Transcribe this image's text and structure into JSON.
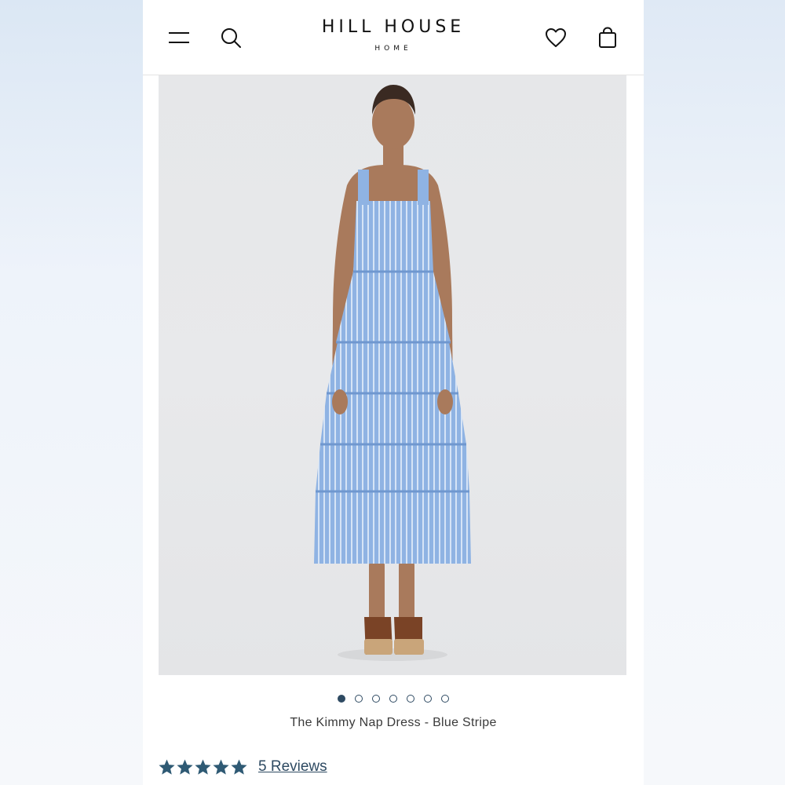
{
  "header": {
    "brand_name": "HILL HOUSE",
    "brand_sub": "HOME",
    "icons": {
      "menu": "hamburger-menu-icon",
      "search": "search-icon",
      "wishlist": "heart-icon",
      "bag": "shopping-bag-icon"
    }
  },
  "product": {
    "title": "The Kimmy Nap Dress - Blue Stripe",
    "image_alt": "model wearing blue stripe tiered midi dress",
    "gallery": {
      "count": 7,
      "active_index": 0
    },
    "rating": {
      "stars": 5,
      "max": 5,
      "reviews_label": "5 Reviews"
    }
  },
  "colors": {
    "accent": "#2e4a62",
    "star": "#2f5a74",
    "dress": "#8fb3e3"
  }
}
